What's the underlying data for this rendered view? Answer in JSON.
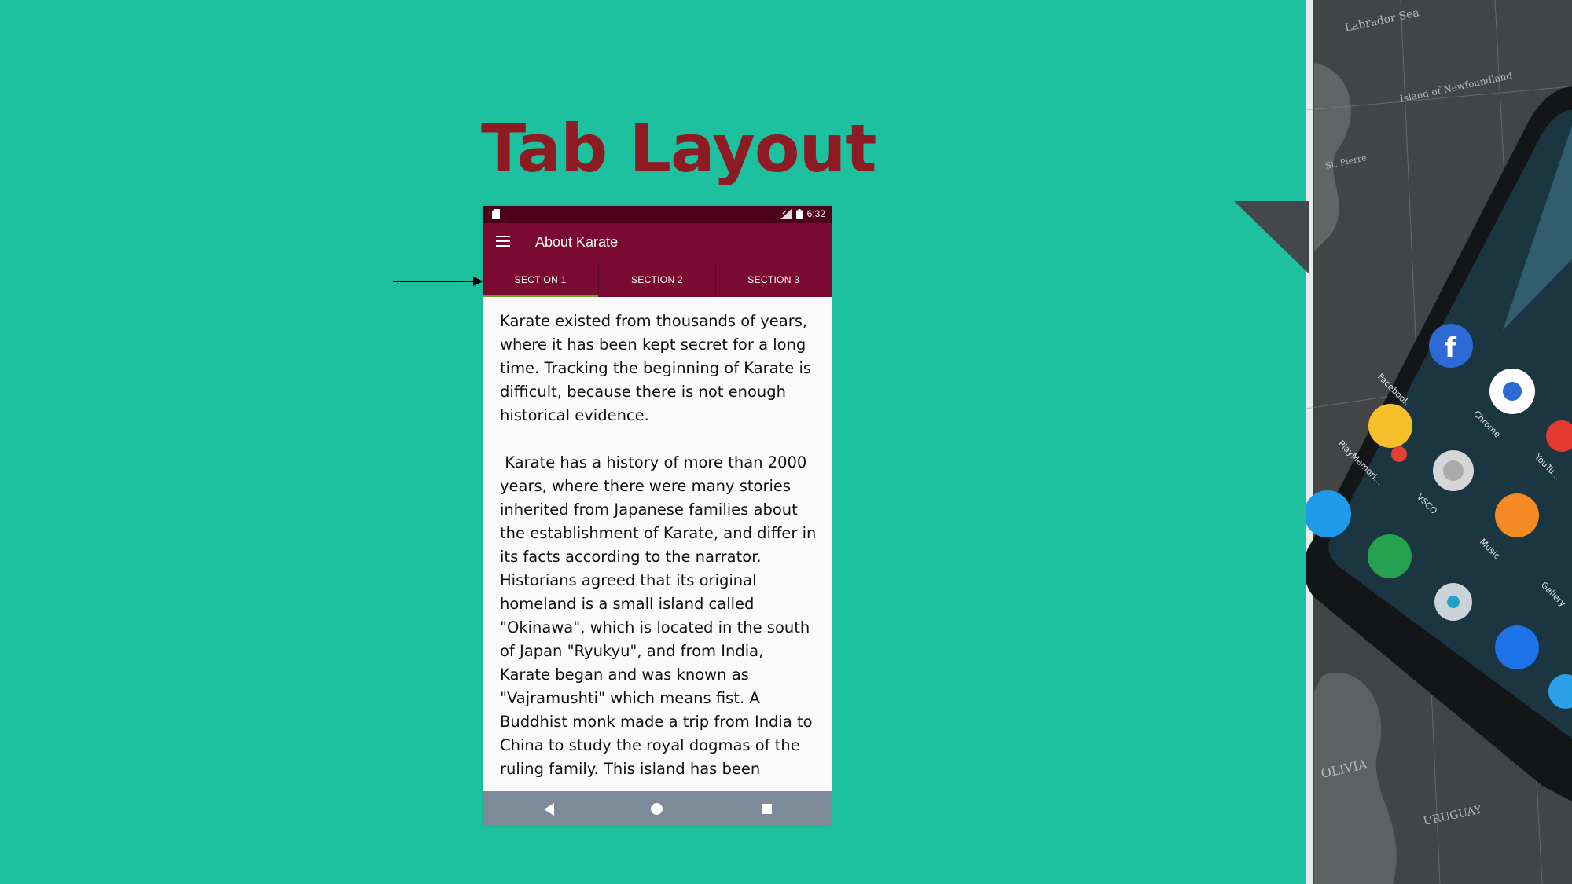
{
  "slide": {
    "title": "Tab Layout"
  },
  "status_bar": {
    "time": "6:32"
  },
  "app_bar": {
    "title": "About Karate",
    "menu_icon": "hamburger-menu-icon"
  },
  "tabs": [
    {
      "label": "SECTION 1",
      "active": true
    },
    {
      "label": "SECTION 2",
      "active": false
    },
    {
      "label": "SECTION 3",
      "active": false
    }
  ],
  "content": {
    "paragraphs": [
      "Karate existed from thousands of years, where it has been kept secret for a long time. Tracking the beginning of Karate is difficult, because there is not enough historical evidence.",
      " Karate has a history of more than 2000 years, where there were many stories inherited from Japanese families about the establishment of Karate, and differ in its facts according to the narrator. Historians agreed that its original homeland is a small island called \"Okinawa\", which is located in the south of Japan \"Ryukyu\", and from India, Karate began and was known as \"Vajramushti\" which means fist. A Buddhist monk made a trip from India to China to study the royal dogmas of the ruling family. This island has been subjected to many occupations"
    ]
  },
  "device_photo": {
    "map_labels": [
      "Labrador Sea",
      "Island of Newfoundland",
      "St. Pierre",
      "OLIVIA",
      "URUGUAY"
    ],
    "app_labels": [
      "Facebook",
      "Chrome",
      "PlayMemori...",
      "VSCO",
      "YouTu...",
      "Music",
      "Gallery"
    ]
  },
  "colors": {
    "slide_background": "#1dc1a0",
    "title_color": "#8e1b24",
    "app_bar": "#7b0a32",
    "status_bar": "#4d0019",
    "tab_indicator": "#6f9f2b",
    "nav_bar": "#7d8a9a"
  }
}
